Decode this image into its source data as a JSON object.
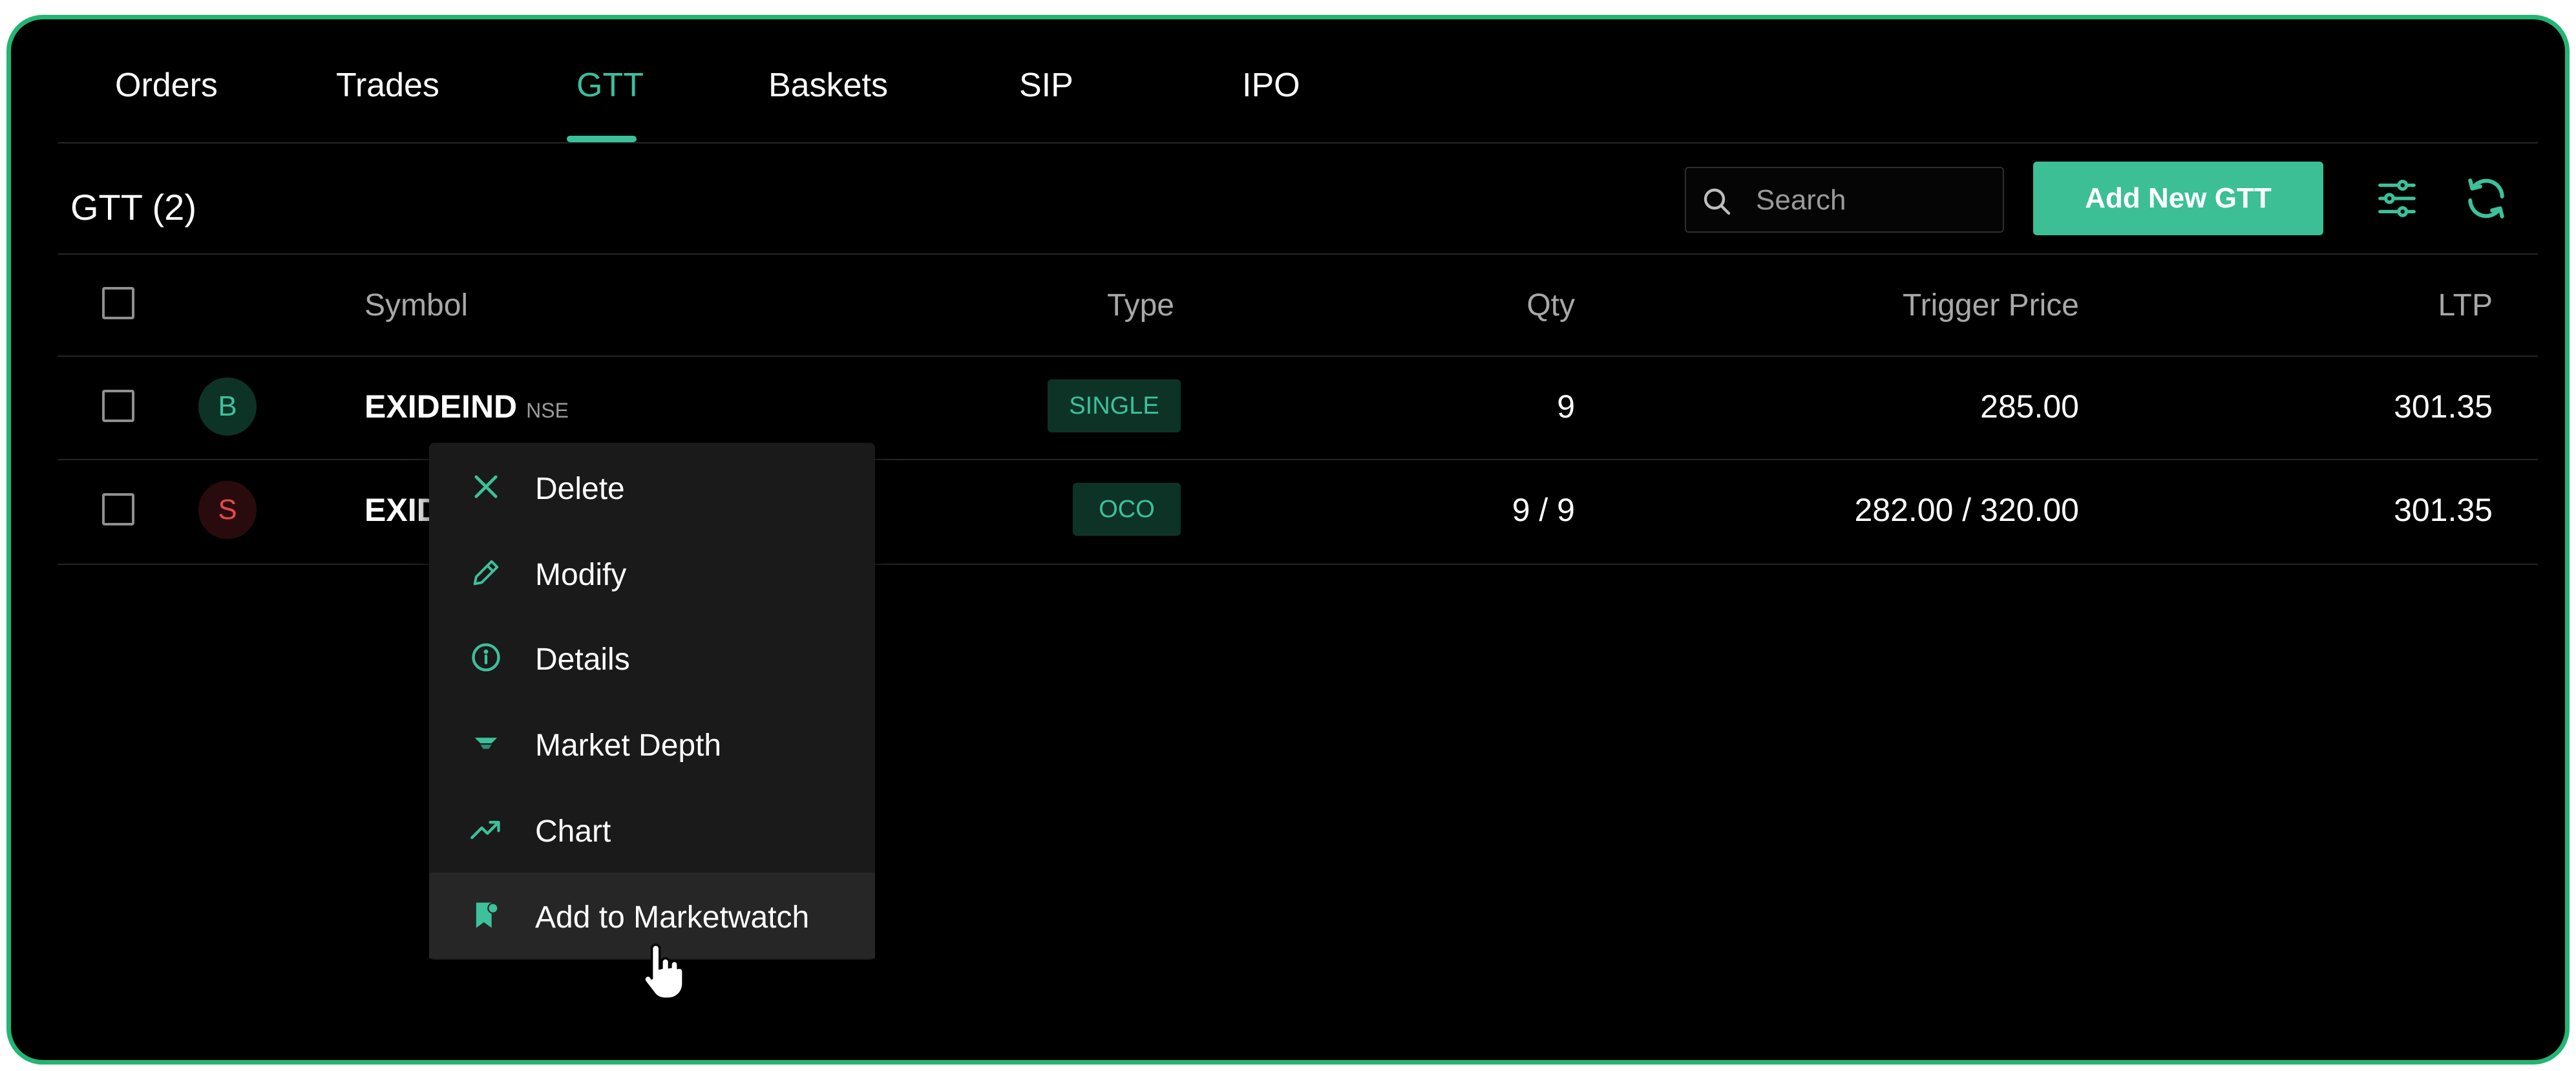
{
  "tabs": [
    {
      "label": "Orders"
    },
    {
      "label": "Trades"
    },
    {
      "label": "GTT",
      "active": true
    },
    {
      "label": "Baskets"
    },
    {
      "label": "SIP"
    },
    {
      "label": "IPO"
    }
  ],
  "header": {
    "title": "GTT (2)",
    "search_placeholder": "Search",
    "add_button_label": "Add New GTT"
  },
  "table": {
    "columns": [
      "Symbol",
      "Type",
      "Qty",
      "Trigger Price",
      "LTP"
    ],
    "rows": [
      {
        "side": "B",
        "symbol": "EXIDEIND",
        "exchange": "NSE",
        "type": "SINGLE",
        "qty": "9",
        "trigger_price": "285.00",
        "ltp": "301.35"
      },
      {
        "side": "S",
        "symbol": "EXID",
        "exchange": "",
        "type": "OCO",
        "qty": "9 / 9",
        "trigger_price": "282.00 / 320.00",
        "ltp": "301.35"
      }
    ]
  },
  "context_menu": {
    "items": [
      {
        "label": "Delete",
        "icon": "close-icon"
      },
      {
        "label": "Modify",
        "icon": "pencil-icon"
      },
      {
        "label": "Details",
        "icon": "info-icon"
      },
      {
        "label": "Market Depth",
        "icon": "depth-icon"
      },
      {
        "label": "Chart",
        "icon": "trend-icon"
      },
      {
        "label": "Add to Marketwatch",
        "icon": "bookmark-add-icon",
        "hovered": true
      }
    ]
  },
  "colors": {
    "accent": "#3cbf95",
    "frame_border": "#22b573",
    "buy": "#3cc19b",
    "sell": "#e5484d"
  }
}
